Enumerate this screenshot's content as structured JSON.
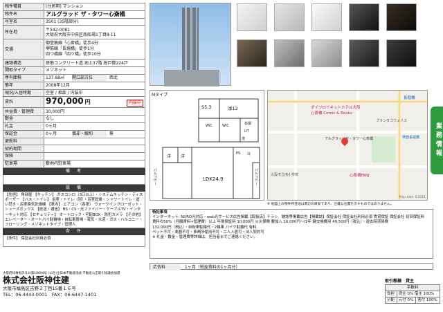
{
  "spec": {
    "type": {
      "k": "物件種目",
      "v": "[住居用] マンション"
    },
    "name": {
      "k": "物件名",
      "v": "アルグラッド ザ・タワー心斎橋"
    },
    "room": {
      "k": "号室名",
      "v": "3501 (35階部分)"
    },
    "address": {
      "k": "所在地",
      "zip": "〒542-0081",
      "v": "大阪府大阪市中央区南船場1丁目8-11"
    },
    "access": {
      "k": "交通",
      "lines": [
        "御堂筋線「心斎橋」徒歩4分",
        "堺筋線「長堀橋」徒歩1分",
        "四つ橋線「四ツ橋」徒歩10分"
      ]
    },
    "structure": {
      "k": "建物構造",
      "v": "鉄筋コンクリート造 地上37階 総戸数224戸"
    },
    "layout": {
      "k": "間取タイプ",
      "v": "メゾネット"
    },
    "area": {
      "k": "専有面積",
      "v": "137.68㎡",
      "k2": "開口部方位",
      "v2": "西北"
    },
    "built": {
      "k": "築年",
      "v": "2008年12月"
    },
    "status": {
      "k": "現況/入居時期",
      "v": "空室 / 相談 / 内装中"
    },
    "rent": {
      "k": "賃料",
      "v": "970,000",
      "unit": "円",
      "badge": "内装中"
    },
    "fee": {
      "k": "共益費・管理費",
      "v": "30,000円"
    },
    "parking": {
      "k": "敷金",
      "v": "なし"
    },
    "deposit": {
      "k": "礼金",
      "v": "0ヶ月"
    },
    "hoshokin": {
      "k": "保証金",
      "v": "0ヶ月",
      "k2": "償却・解約",
      "v2": "無"
    },
    "renew": {
      "k": "更新料",
      "v": ""
    },
    "renew2": {
      "k": "契約期間",
      "v": ""
    },
    "insurance": {
      "k": "保険",
      "v": ""
    },
    "park2": {
      "k": "駐車場",
      "v": "敷地内駐車場"
    }
  },
  "sections": {
    "remarks": "備　考",
    "facilities": "設　備",
    "conditions": "条　件"
  },
  "facilities_text": "【住居】 角部屋 【キッチン】 ガスコンロ（3口以上）・システムキッチン・ディスポーザー 【バス・トイレ】 浴室・トイレ（別）・浴室乾燥・シャワートイレ・追い焚き・浴室換気乾燥機 【室内】 エアコン（各室） ウォークインクローゼット・シューズボックス 【放送・通信】 BS・CS・光ファイバー・ケーブルTV・インターネット対応 【セキュリティ】 オートロック・宅配BOX・防犯カメラ 【その他】 エレベーター・オートバイ駐輪場・自転車置場・電気・水道・ガス・バルコニー・フローリング・メゾネットタイプ・管理人",
  "conditions_text": "【条件】 保証会社利用必須",
  "floorplan": {
    "label": "Mタイプ",
    "rooms": [
      "S5.3",
      "洋12",
      "WIC",
      "WIC",
      "洋",
      "洋",
      "LDK24.9",
      "UT",
      "バルコニー",
      "バルコニー",
      "玄関",
      "PS",
      "冷",
      "洗"
    ]
  },
  "map": {
    "labels": [
      "ダイワロイネットホテル大阪",
      "心斎橋 Comic & Books",
      "プランタゴウェリス",
      "大阪市立南小学校",
      "心斎橋FANJ",
      "堺筋長堀橋",
      "長堀橋",
      "アルグラッドザ・タワー心斎橋"
    ],
    "credit": "Map data ©2021"
  },
  "map_note": "※ 地図上の物件所在地は周辺の目安であり、正確な位置を示すものではありません。",
  "notes": {
    "title": "特記事項",
    "lines": [
      "インターネット: NURO光対応・web光サービス広告掲載【取扱店】チラシ、雑誌等掲載広告【掲載誌】保証会社 保証会社利用必須 賃貸保証 保証会社 初回保証料",
      "賃料の50%（月額賃料+管理費）以上 年間保証料 10,000円 火災保険 要加入 16,000円〜/2年 鍵交換費用 49,500円（税込）・退去時清掃費",
      "132,000円（税込）・自転車駐輪代・2輪車 バイク駐輪代 有料",
      "ペット不可・楽器不可・事務所使用不可・二人入居可・法人契約可",
      "※ 礼金・敷金・管理費等詳細は、担当者までご連絡ください。"
    ]
  },
  "ad": {
    "k": "広告料",
    "v": "1ヶ月（税抜賃料の1ヶ月分）"
  },
  "company": {
    "license": "大阪府知事免許(14)第18894号 (公社)全日本不動産協会 不動産公正取引協議会加盟",
    "name": "株式会社阪神住建",
    "address": "大阪市福島区吉野２丁目15番１６号",
    "tel": "TEL：06-4443-0001",
    "fax": "FAX：06-6447-1401"
  },
  "fee_table": {
    "title": "取引態様　貸主",
    "hdr": "手数料",
    "rows": [
      [
        "負担",
        "",
        "貸主 0% 借主 100%"
      ],
      [
        "分配",
        "元付 0%",
        "客付 100%"
      ]
    ]
  },
  "side_tab": "業務情報"
}
